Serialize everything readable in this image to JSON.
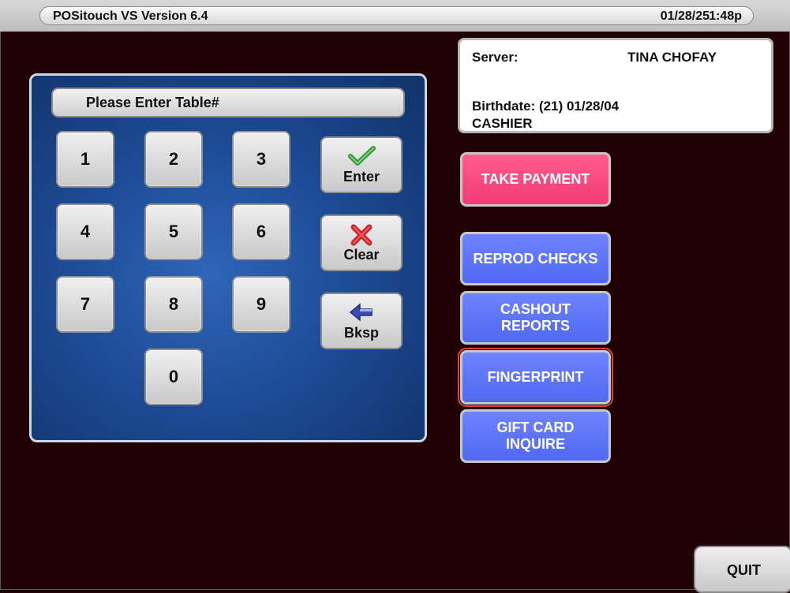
{
  "header": {
    "app_title": "POSitouch VS Version 6.4",
    "date": "01/28/25",
    "time": "1:48p"
  },
  "keypad": {
    "prompt": "Please Enter Table#",
    "keys": [
      "1",
      "2",
      "3",
      "4",
      "5",
      "6",
      "7",
      "8",
      "9",
      "0"
    ],
    "enter_label": "Enter",
    "clear_label": "Clear",
    "bksp_label": "Bksp"
  },
  "info": {
    "server_label": "Server:",
    "server_name": "TINA CHOFAY",
    "birthdate": "Birthdate: (21) 01/28/04",
    "role": "CASHIER"
  },
  "actions": {
    "take_payment": "TAKE  PAYMENT",
    "reprod_checks": "REPROD CHECKS",
    "cashout_line1": "CASHOUT",
    "cashout_line2": "REPORTS",
    "fingerprint": "FINGERPRINT",
    "giftcard_line1": "GIFT CARD",
    "giftcard_line2": "INQUIRE"
  },
  "quit_label": "QUIT",
  "colors": {
    "background": "#200204",
    "panel_blue": "#1e4c97",
    "action_blue": "#5a70f8",
    "take_payment_pink": "#f2457f",
    "highlight": "#e0443c"
  }
}
